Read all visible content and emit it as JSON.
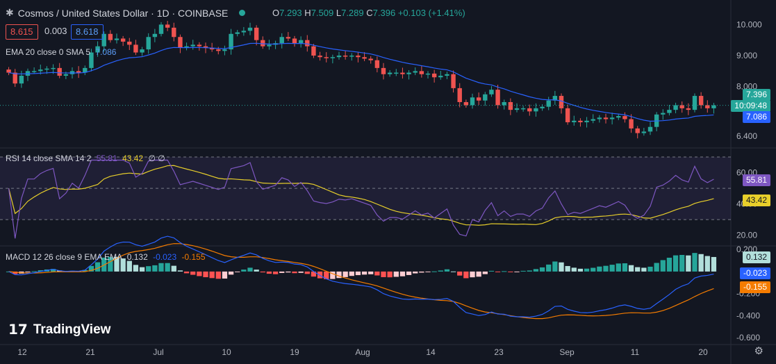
{
  "header": {
    "symbol_title": "Cosmos / United States Dollar · 1D · COINBASE",
    "ohlc": {
      "o_label": "O",
      "o": "7.293",
      "h_label": "H",
      "h": "7.509",
      "l_label": "L",
      "l": "7.289",
      "c_label": "C",
      "c": "7.396",
      "change": "+0.103 (+1.41%)"
    },
    "sell_price": "8.615",
    "spread": "0.003",
    "buy_price": "8.618",
    "ema_label": "EMA 20 close 0 SMA 5",
    "ema_value": "7.086"
  },
  "price_axis": {
    "ticks": [
      "10.000",
      "9.000",
      "8.000",
      "6.400"
    ],
    "last_price": "7.396",
    "countdown": "10:09:48",
    "ema_price": "7.086"
  },
  "rsi": {
    "label": "RSI 14 close SMA 14 2",
    "rsi_value": "55.81",
    "sma_value": "43.42",
    "extras": "∅ ∅",
    "ticks": [
      "60.00",
      "40.00",
      "20.00"
    ]
  },
  "macd": {
    "label": "MACD 12 26 close 9 EMA EMA",
    "hist": "0.132",
    "macd_value": "-0.023",
    "signal_value": "-0.155",
    "ticks": [
      "0.200",
      "-0.200",
      "-0.400",
      "-0.600"
    ]
  },
  "time_axis": [
    "12",
    "21",
    "Jul",
    "10",
    "19",
    "Aug",
    "14",
    "23",
    "Sep",
    "11",
    "20"
  ],
  "brand": "TradingView",
  "colors": {
    "up": "#26a69a",
    "down": "#ef5350",
    "ema": "#2962ff",
    "rsi": "#7e57c2",
    "rsi_sma": "#e8cf2b",
    "signal": "#f57c00"
  },
  "chart_data": {
    "type": "candlestick",
    "closes": [
      8.45,
      8.1,
      8.35,
      8.5,
      8.5,
      8.55,
      8.58,
      8.6,
      8.35,
      8.4,
      8.5,
      8.45,
      8.6,
      9.1,
      9.3,
      9.7,
      9.5,
      9.55,
      9.45,
      9.35,
      9.1,
      9.2,
      9.6,
      9.7,
      10.0,
      9.9,
      9.6,
      9.25,
      9.3,
      9.35,
      9.3,
      9.25,
      9.2,
      9.15,
      9.2,
      9.7,
      9.75,
      9.8,
      9.9,
      9.5,
      9.3,
      9.35,
      9.4,
      9.6,
      9.55,
      9.4,
      9.5,
      9.3,
      9.0,
      8.95,
      8.92,
      8.95,
      9.0,
      8.98,
      9.0,
      8.95,
      8.9,
      8.85,
      8.6,
      8.4,
      8.45,
      8.45,
      8.4,
      8.45,
      8.5,
      8.4,
      8.42,
      8.3,
      8.35,
      8.4,
      7.95,
      7.5,
      7.4,
      7.65,
      7.55,
      7.75,
      7.9,
      7.4,
      7.5,
      7.25,
      7.3,
      7.3,
      7.2,
      7.3,
      7.35,
      7.55,
      7.7,
      7.3,
      6.85,
      6.9,
      6.85,
      6.9,
      6.95,
      7.0,
      6.95,
      7.0,
      7.05,
      6.95,
      6.65,
      6.5,
      6.55,
      6.7,
      7.1,
      7.15,
      7.25,
      7.4,
      7.3,
      7.25,
      7.7,
      7.4,
      7.3,
      7.396
    ],
    "ema20_last": 7.086,
    "rsi_last": 55.81,
    "rsi_sma_last": 43.42,
    "macd_last": -0.023,
    "signal_last": -0.155,
    "hist_last": 0.132,
    "price_ylim": [
      6.2,
      10.3
    ],
    "rsi_ylim": [
      15,
      70
    ],
    "macd_ylim": [
      -0.65,
      0.22
    ]
  }
}
